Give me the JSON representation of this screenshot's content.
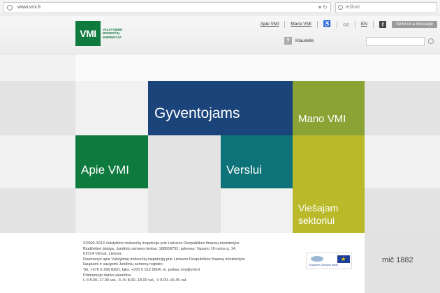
{
  "browser": {
    "url": "www.vmi.lt",
    "search_placeholder": "ieškoti",
    "reload_icon": "reload-icon",
    "dropdown_icon": "chevron-down-icon"
  },
  "header": {
    "logo_abbr": "VMI",
    "logo_text": "VALSTYBINĖ MOKESČIŲ INSPEKCIJA",
    "links": {
      "apie": "Apie VMI",
      "mano": "Mano VMI",
      "accessibility_icon": "wheelchair-icon",
      "glasses_icon": "glasses-icon",
      "en": "EN",
      "fb": "f",
      "button": "Send us a message"
    },
    "help_label": "Klauskite",
    "help_icon": "question-icon"
  },
  "tiles": {
    "gyventojams": "Gyventojams",
    "mano_vmi": "Mano VMI",
    "apie_vmi": "Apie VMI",
    "verslui": "Verslui",
    "viesajam": "Viešajam",
    "viesajam2": "sektoriui"
  },
  "colors": {
    "navy": "#1b447a",
    "teal": "#0e7378",
    "green": "#0f7a3e",
    "olive": "#8aa334",
    "yellow_olive": "#b9b92a"
  },
  "footer": {
    "line1": "©2000-2013 Valstybinė mokesčių inspekcija prie Lietuvos Respublikos finansų ministerijos",
    "line2": "Biudžetinė įstaiga. Juridinio asmens kodas: 188659752, adresas: Vasario 16-osios g. 14,",
    "line3": "01514 Vilnius, Lietuva",
    "line4": "Duomenys apie Valstybinę mokesčių inspekciją prie Lietuvos Respublikos finansų ministerijos",
    "line5": "kaupiami ir saugomi Juridinių asmenų registre.",
    "line6": "Tel. +370 5 266 8200, faks. +370 5 212 5604, el. paštas vmi@vmi.lt",
    "line7": "Priimamojo darbo valandos:",
    "line8": "I–II 8.00–17.00 val., II–IV 8.00–18.00 val., V 8.00–15.45 val.",
    "eu_caption": "Kuriame Lietuvos ateitį",
    "mit": "1882",
    "mit_prefix": "mič"
  }
}
